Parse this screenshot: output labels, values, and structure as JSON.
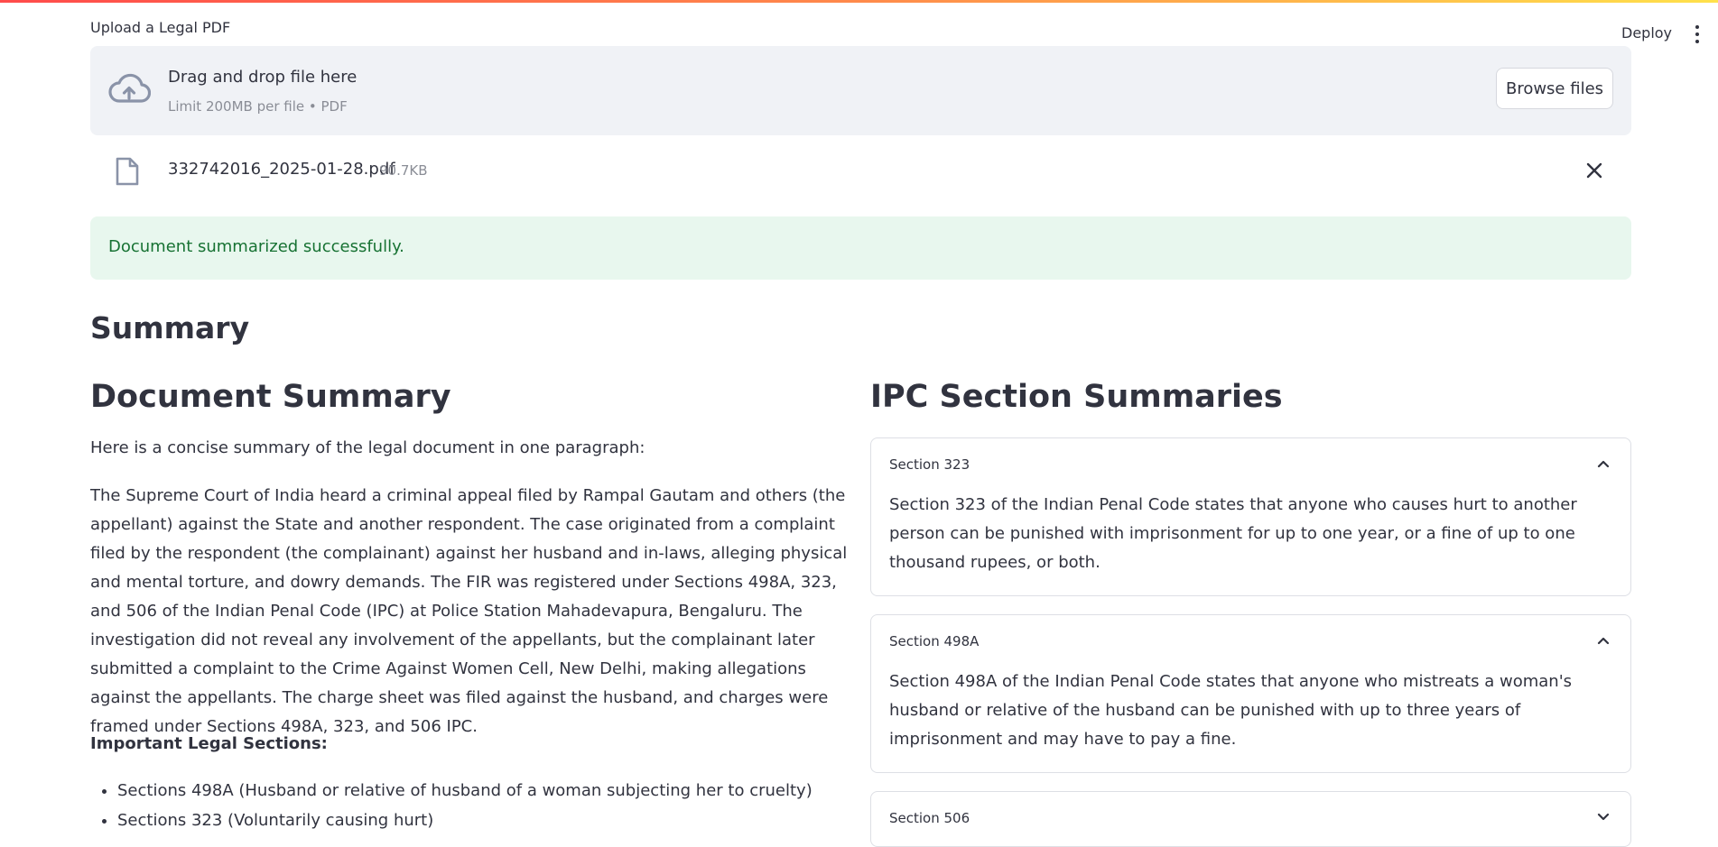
{
  "header": {
    "deploy_label": "Deploy",
    "menu_icon": "vertical-ellipsis-icon"
  },
  "uploader": {
    "label": "Upload a Legal PDF",
    "drop_title": "Drag and drop file here",
    "drop_subtitle": "Limit 200MB per file • PDF",
    "browse_label": "Browse files",
    "drop_icon": "cloud-upload-icon",
    "file": {
      "name": "332742016_2025-01-28.pdf",
      "size": "90.7KB",
      "icon": "file-icon",
      "remove_icon": "close-icon"
    }
  },
  "alert": {
    "message": "Document summarized successfully.",
    "background": "#e8f7ee",
    "text_color": "#177233"
  },
  "page": {
    "summary_heading": "Summary"
  },
  "document_summary": {
    "heading": "Document Summary",
    "intro": "Here is a concise summary of the legal document in one paragraph:",
    "paragraph": "The Supreme Court of India heard a criminal appeal filed by Rampal Gautam and others (the appellant) against the State and another respondent. The case originated from a complaint filed by the respondent (the complainant) against her husband and in-laws, alleging physical and mental torture, and dowry demands. The FIR was registered under Sections 498A, 323, and 506 of the Indian Penal Code (IPC) at Police Station Mahadevapura, Bengaluru. The investigation did not reveal any involvement of the appellants, but the complainant later submitted a complaint to the Crime Against Women Cell, New Delhi, making allegations against the appellants. The charge sheet was filed against the husband, and charges were framed under Sections 498A, 323, and 506 IPC.",
    "legal_sections_heading": "Important Legal Sections:",
    "legal_sections": [
      "Sections 498A (Husband or relative of husband of a woman subjecting her to cruelty)",
      "Sections 323 (Voluntarily causing hurt)"
    ]
  },
  "ipc": {
    "heading": "IPC Section Summaries",
    "sections": [
      {
        "title": "Section 323",
        "expanded": true,
        "body": "Section 323 of the Indian Penal Code states that anyone who causes hurt to another person can be punished with imprisonment for up to one year, or a fine of up to one thousand rupees, or both."
      },
      {
        "title": "Section 498A",
        "expanded": true,
        "body": "Section 498A of the Indian Penal Code states that anyone who mistreats a woman's husband or relative of the husband can be punished with up to three years of imprisonment and may have to pay a fine."
      },
      {
        "title": "Section 506",
        "expanded": false,
        "body": ""
      }
    ]
  }
}
